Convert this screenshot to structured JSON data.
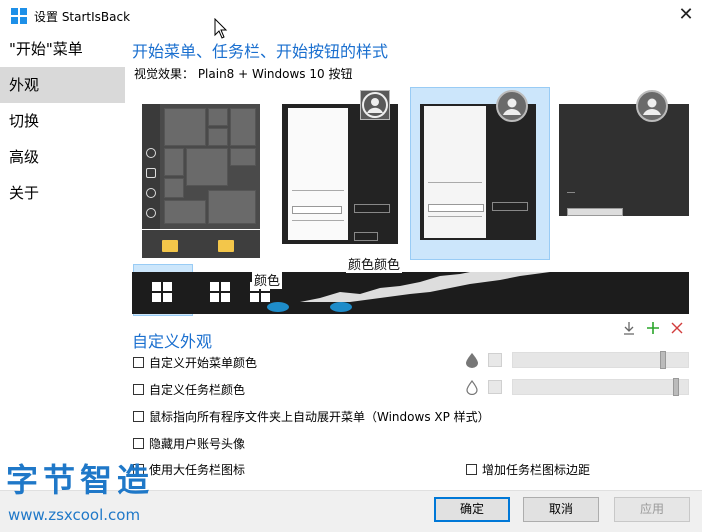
{
  "window": {
    "title": "设置 StartIsBack",
    "close_glyph": "✕"
  },
  "sidebar": {
    "items": [
      {
        "label": "\"开始\"菜单",
        "active": false
      },
      {
        "label": "外观",
        "active": true
      },
      {
        "label": "切换",
        "active": false
      },
      {
        "label": "高级",
        "active": false
      },
      {
        "label": "关于",
        "active": false
      }
    ]
  },
  "main": {
    "styles_title": "开始菜单、任务栏、开始按钮的样式",
    "visual_effect": "视觉效果： Plain8 + Windows 10 按钮",
    "overlay_labels": [
      "颜色",
      "颜色颜色"
    ]
  },
  "customize": {
    "title": "自定义外观",
    "toolbar_icons": [
      "download-icon",
      "add-icon",
      "remove-icon"
    ],
    "options": [
      {
        "label": "自定义开始菜单颜色",
        "checked": false
      },
      {
        "label": "自定义任务栏颜色",
        "checked": false
      },
      {
        "label": "鼠标指向所有程序文件夹上自动展开菜单（Windows XP 样式）",
        "checked": false
      },
      {
        "label": "隐藏用户账号头像",
        "checked": false
      },
      {
        "label": "使用大任务栏图标",
        "checked": false
      },
      {
        "label": "增加任务栏图标边距",
        "checked": false
      }
    ],
    "sliders": [
      {
        "value": 0.88
      },
      {
        "value": 0.96
      }
    ]
  },
  "buttons": {
    "ok": "确定",
    "cancel": "取消",
    "apply": "应用"
  },
  "watermark": {
    "title": "字节智造",
    "url": "www.zsxcool.com"
  },
  "colors": {
    "accent": "#1a6fcf",
    "selection": "#cce6fb",
    "add_icon": "#2aa52a",
    "remove_icon": "#d23c3c"
  }
}
